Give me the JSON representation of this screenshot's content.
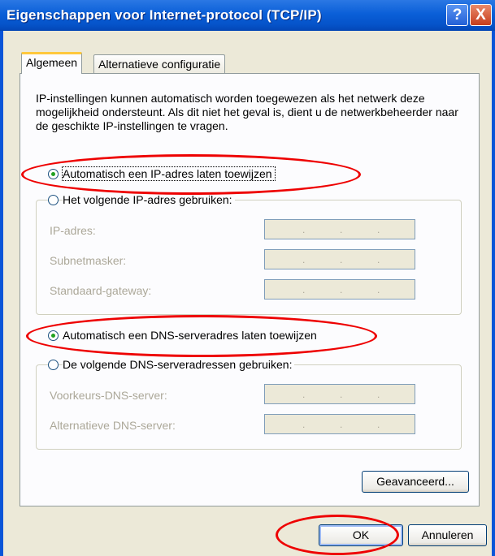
{
  "window": {
    "title": "Eigenschappen voor Internet-protocol (TCP/IP)"
  },
  "titlebar_buttons": {
    "help": "?",
    "close": "X"
  },
  "tabs": [
    {
      "label": "Algemeen",
      "active": true
    },
    {
      "label": "Alternatieve configuratie",
      "active": false
    }
  ],
  "description": "IP-instellingen kunnen automatisch worden toegewezen als het netwerk deze mogelijkheid ondersteunt. Als dit niet het geval is, dient u de netwerkbeheerder naar de geschikte IP-instellingen te vragen.",
  "ip": {
    "auto_label": "Automatisch een IP-adres laten toewijzen",
    "auto_checked": true,
    "manual_label": "Het volgende IP-adres gebruiken:",
    "manual_checked": false,
    "fields": [
      {
        "label": "IP-adres:",
        "value": ". . ."
      },
      {
        "label": "Subnetmasker:",
        "value": ". . ."
      },
      {
        "label": "Standaard-gateway:",
        "value": ". . ."
      }
    ]
  },
  "dns": {
    "auto_label": "Automatisch een DNS-serveradres laten toewijzen",
    "auto_checked": true,
    "manual_label": "De volgende DNS-serveradressen gebruiken:",
    "manual_checked": false,
    "fields": [
      {
        "label": "Voorkeurs-DNS-server:",
        "value": ". . ."
      },
      {
        "label": "Alternatieve DNS-server:",
        "value": ". . ."
      }
    ]
  },
  "buttons": {
    "advanced": "Geavanceerd...",
    "ok": "OK",
    "cancel": "Annuleren"
  },
  "colors": {
    "titlebar": "#0a5fd8",
    "dialog_bg": "#ece9d8",
    "annotation": "#e00000",
    "radio_dot": "#21a121"
  },
  "icons": {
    "help": "help-icon",
    "close": "close-icon"
  }
}
